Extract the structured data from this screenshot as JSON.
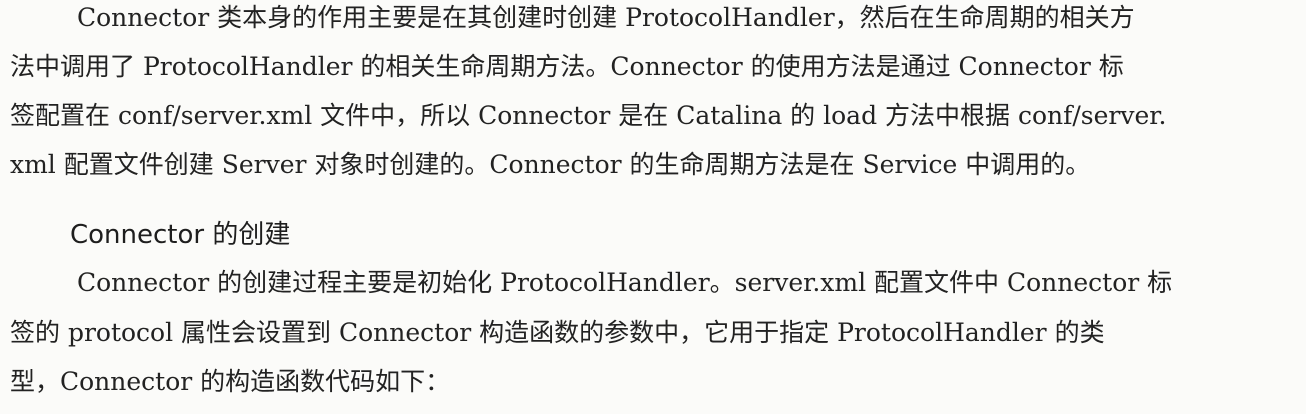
{
  "paragraph1": {
    "lines": [
      "Connector 类本身的作用主要是在其创建时创建 ProtocolHandler，然后在生命周期的相关方",
      "法中调用了 ProtocolHandler 的相关生命周期方法。Connector 的使用方法是通过 Connector 标",
      "签配置在 conf/server.xml 文件中，所以 Connector 是在 Catalina 的 load 方法中根据 conf/server.",
      "xml 配置文件创建 Server 对象时创建的。Connector 的生命周期方法是在 Service 中调用的。"
    ]
  },
  "section_heading": "Connector 的创建",
  "paragraph2": {
    "lines": [
      "Connector 的创建过程主要是初始化 ProtocolHandler。server.xml 配置文件中 Connector 标",
      "签的 protocol 属性会设置到 Connector 构造函数的参数中，它用于指定 ProtocolHandler 的类",
      "型，Connector 的构造函数代码如下："
    ]
  }
}
